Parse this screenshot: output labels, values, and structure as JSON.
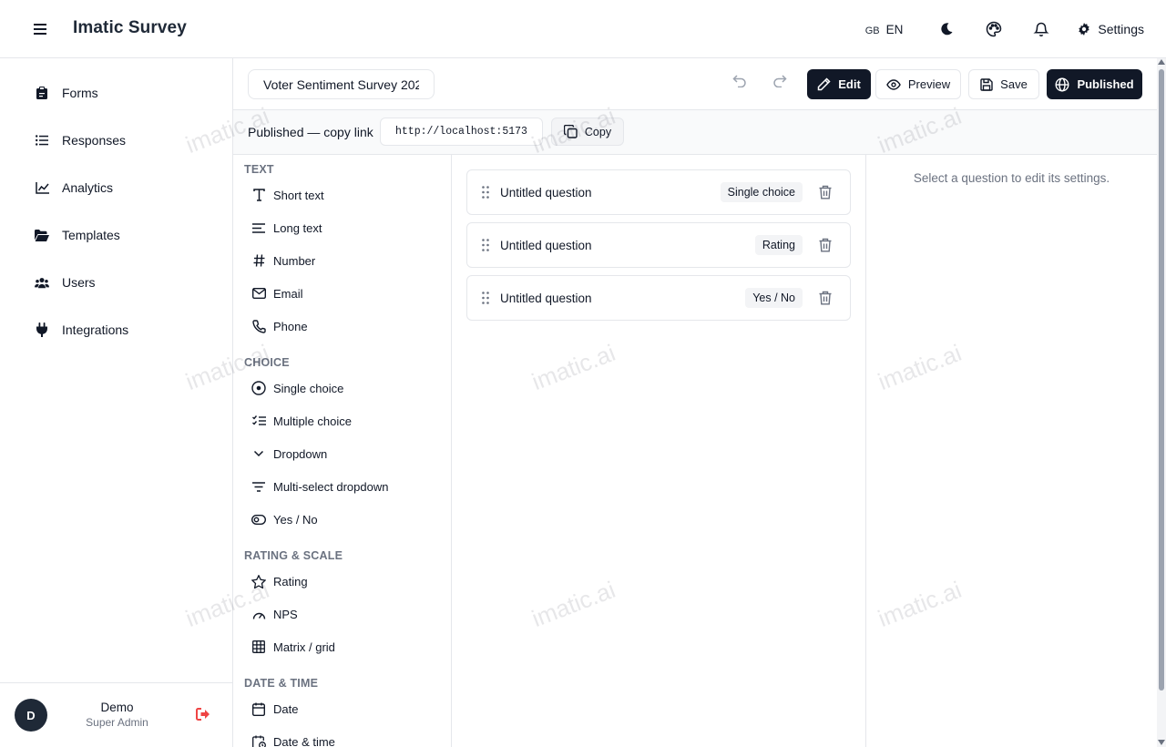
{
  "header": {
    "app_title": "Imatic Survey",
    "lang_flag": "GB",
    "lang_code": "EN",
    "settings_label": "Settings"
  },
  "sidebar": {
    "items": [
      {
        "label": "Forms",
        "icon": "clipboard-icon"
      },
      {
        "label": "Responses",
        "icon": "list-icon"
      },
      {
        "label": "Analytics",
        "icon": "chart-line-icon"
      },
      {
        "label": "Templates",
        "icon": "folder-open-icon"
      },
      {
        "label": "Users",
        "icon": "users-icon"
      },
      {
        "label": "Integrations",
        "icon": "plug-icon"
      }
    ],
    "user": {
      "initial": "D",
      "name": "Demo",
      "role": "Super Admin"
    }
  },
  "toolbar": {
    "form_title": "Voter Sentiment Survey 202",
    "edit_label": "Edit",
    "preview_label": "Preview",
    "save_label": "Save",
    "published_label": "Published"
  },
  "publish_bar": {
    "label": "Published — copy link",
    "url": "http://localhost:5173/",
    "copy_label": "Copy"
  },
  "palette": {
    "sections": [
      {
        "title": "TEXT",
        "items": [
          {
            "label": "Short text",
            "icon": "text-type-icon"
          },
          {
            "label": "Long text",
            "icon": "align-left-icon"
          },
          {
            "label": "Number",
            "icon": "hash-icon"
          },
          {
            "label": "Email",
            "icon": "mail-icon"
          },
          {
            "label": "Phone",
            "icon": "phone-icon"
          }
        ]
      },
      {
        "title": "CHOICE",
        "items": [
          {
            "label": "Single choice",
            "icon": "radio-circle-icon"
          },
          {
            "label": "Multiple choice",
            "icon": "list-checks-icon"
          },
          {
            "label": "Dropdown",
            "icon": "chevron-down-icon"
          },
          {
            "label": "Multi-select dropdown",
            "icon": "filter-icon"
          },
          {
            "label": "Yes / No",
            "icon": "toggle-icon"
          }
        ]
      },
      {
        "title": "RATING & SCALE",
        "items": [
          {
            "label": "Rating",
            "icon": "star-icon"
          },
          {
            "label": "NPS",
            "icon": "gauge-icon"
          },
          {
            "label": "Matrix / grid",
            "icon": "grid-icon"
          }
        ]
      },
      {
        "title": "DATE & TIME",
        "items": [
          {
            "label": "Date",
            "icon": "calendar-icon"
          },
          {
            "label": "Date & time",
            "icon": "calendar-clock-icon"
          }
        ]
      }
    ]
  },
  "questions": [
    {
      "text": "Untitled question",
      "type": "Single choice"
    },
    {
      "text": "Untitled question",
      "type": "Rating"
    },
    {
      "text": "Untitled question",
      "type": "Yes / No"
    }
  ],
  "settings_panel": {
    "hint": "Select a question to edit its settings."
  },
  "watermark": "imatic.ai",
  "colors": {
    "primary_dark": "#111827",
    "border": "#e5e7eb",
    "muted_text": "#6b7280",
    "logout_red": "#ef4444"
  }
}
